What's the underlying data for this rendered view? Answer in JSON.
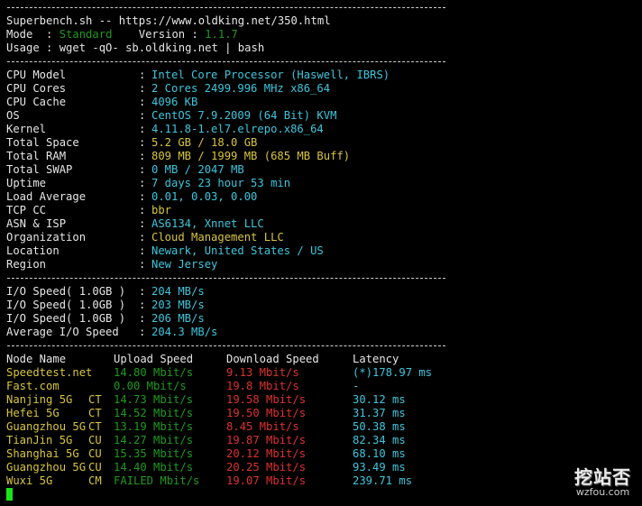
{
  "header": {
    "title_line": "Superbench.sh -- https://www.oldking.net/350.html",
    "mode_label": "Mode  : ",
    "mode_value": "Standard",
    "version_label": "    Version : ",
    "version_value": "1.1.7",
    "usage_line": "Usage : wget -qO- sb.oldking.net | bash"
  },
  "system_info": [
    {
      "key": "CPU Model",
      "value": "Intel Core Processor (Haswell, IBRS)",
      "color": "cyan"
    },
    {
      "key": "CPU Cores",
      "value": "2 Cores 2499.996 MHz x86_64",
      "color": "cyan"
    },
    {
      "key": "CPU Cache",
      "value": "4096 KB",
      "color": "cyan"
    },
    {
      "key": "OS",
      "value": "CentOS 7.9.2009 (64 Bit) KVM",
      "color": "cyan"
    },
    {
      "key": "Kernel",
      "value": "4.11.8-1.el7.elrepo.x86_64",
      "color": "cyan"
    },
    {
      "key": "Total Space",
      "value": "5.2 GB / 18.0 GB",
      "color": "yellow"
    },
    {
      "key": "Total RAM",
      "value": "809 MB / 1999 MB (685 MB Buff)",
      "color": "yellow"
    },
    {
      "key": "Total SWAP",
      "value": "0 MB / 2047 MB",
      "color": "cyan"
    },
    {
      "key": "Uptime",
      "value": "7 days 23 hour 53 min",
      "color": "cyan"
    },
    {
      "key": "Load Average",
      "value": "0.01, 0.03, 0.00",
      "color": "cyan"
    },
    {
      "key": "TCP CC",
      "value": "bbr",
      "color": "yellow"
    },
    {
      "key": "ASN & ISP",
      "value": "AS6134, Xnnet LLC",
      "color": "cyan"
    },
    {
      "key": "Organization",
      "value": "Cloud Management LLC",
      "color": "yellow"
    },
    {
      "key": "Location",
      "value": "Newark, United States / US",
      "color": "cyan"
    },
    {
      "key": "Region",
      "value": "New Jersey",
      "color": "cyan"
    }
  ],
  "io_speed": [
    {
      "key": "I/O Speed( 1.0GB )",
      "value": "204 MB/s"
    },
    {
      "key": "I/O Speed( 1.0GB )",
      "value": "203 MB/s"
    },
    {
      "key": "I/O Speed( 1.0GB )",
      "value": "206 MB/s"
    },
    {
      "key": "Average I/O Speed",
      "value": "204.3 MB/s"
    }
  ],
  "speedtest": {
    "headers": [
      "Node Name",
      "Upload Speed",
      "Download Speed",
      "Latency"
    ],
    "rows": [
      {
        "node": "Speedtest.net",
        "isp": "",
        "upload": "14.80 Mbit/s",
        "download": "9.13 Mbit/s",
        "latency": "(*)178.97 ms"
      },
      {
        "node": "Fast.com",
        "isp": "",
        "upload": "0.00 Mbit/s",
        "download": "19.8 Mbit/s",
        "latency": "-"
      },
      {
        "node": "Nanjing 5G",
        "isp": "CT",
        "upload": "14.73 Mbit/s",
        "download": "19.58 Mbit/s",
        "latency": "30.12 ms"
      },
      {
        "node": "Hefei 5G",
        "isp": "CT",
        "upload": "14.52 Mbit/s",
        "download": "19.50 Mbit/s",
        "latency": "31.37 ms"
      },
      {
        "node": "Guangzhou 5G",
        "isp": "CT",
        "upload": "13.19 Mbit/s",
        "download": "8.45 Mbit/s",
        "latency": "50.38 ms"
      },
      {
        "node": "TianJin 5G",
        "isp": "CU",
        "upload": "14.27 Mbit/s",
        "download": "19.87 Mbit/s",
        "latency": "82.34 ms"
      },
      {
        "node": "Shanghai 5G",
        "isp": "CU",
        "upload": "15.35 Mbit/s",
        "download": "20.12 Mbit/s",
        "latency": "68.10 ms"
      },
      {
        "node": "Guangzhou 5G",
        "isp": "CU",
        "upload": "14.40 Mbit/s",
        "download": "20.25 Mbit/s",
        "latency": "93.49 ms"
      },
      {
        "node": "Wuxi 5G",
        "isp": "CM",
        "upload": "FAILED Mbit/s",
        "download": "19.07 Mbit/s",
        "latency": "239.71 ms"
      }
    ]
  },
  "watermark": {
    "name": "挖站否",
    "url": "wzfou.com"
  },
  "colors": {
    "background": "#000000",
    "text": "#e6e6e6",
    "green": "#1e9a1e",
    "red": "#e03030",
    "cyan": "#3ec6dc",
    "yellow": "#d8c53c",
    "cursor": "#19e619"
  }
}
